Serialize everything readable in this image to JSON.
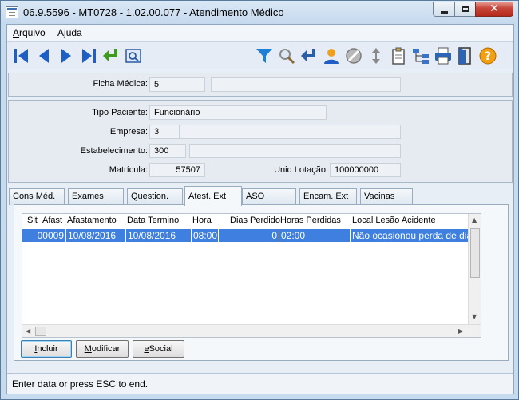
{
  "window": {
    "title": "06.9.5596 - MT0728 - 1.02.00.077 - Atendimento Médico",
    "close_glyph": "✕"
  },
  "menu": {
    "arquivo": {
      "first": "A",
      "rest": "rquivo"
    },
    "ajuda": {
      "first": "A",
      "underline": "j",
      "rest": "uda"
    }
  },
  "toolbar": {
    "icons": [
      "first-record-icon",
      "previous-record-icon",
      "next-record-icon",
      "last-record-icon",
      "return-icon",
      "zoom-icon",
      "filter-icon",
      "search-icon",
      "go-to-icon",
      "user-icon",
      "cancel-icon",
      "sort-icon",
      "clipboard-icon",
      "tree-icon",
      "print-icon",
      "exit-icon",
      "help-icon"
    ]
  },
  "form": {
    "ficha_label": "Ficha Médica:",
    "ficha_value": "5",
    "ficha_desc": "",
    "tipo_label": "Tipo Paciente:",
    "tipo_value": "Funcionário",
    "empresa_label": "Empresa:",
    "empresa_value": "3",
    "empresa_desc": "",
    "estab_label": "Estabelecimento:",
    "estab_value": "300",
    "estab_desc": "",
    "matricula_label": "Matrícula:",
    "matricula_value": "57507",
    "unid_label": "Unid Lotação:",
    "unid_value": "100000000"
  },
  "tabs": [
    "Cons Méd.",
    "Exames",
    "Question.",
    "Atest. Ext",
    "ASO",
    "Encam. Ext",
    "Vacinas"
  ],
  "active_tab": "Atest. Ext",
  "grid": {
    "columns": [
      "Sit",
      "Afast",
      "Afastamento",
      "Data Termino",
      "Hora",
      "Dias Perdido",
      "Horas Perdidas",
      "Local Lesão Acidente"
    ],
    "rows": [
      {
        "afast": "00009",
        "afastamento": "10/08/2016",
        "data_termino": "10/08/2016",
        "hora": "08:00",
        "dias_perdido": "0",
        "horas_perdidas": "02:00",
        "local_lesao": "Não ocasionou perda de dia"
      }
    ]
  },
  "buttons": {
    "incluir": {
      "first": "I",
      "rest": "ncluir"
    },
    "modificar": {
      "first": "M",
      "rest": "odificar"
    },
    "esocial": {
      "first": "e",
      "rest": "Social"
    }
  },
  "status": "Enter data or press ESC to end."
}
